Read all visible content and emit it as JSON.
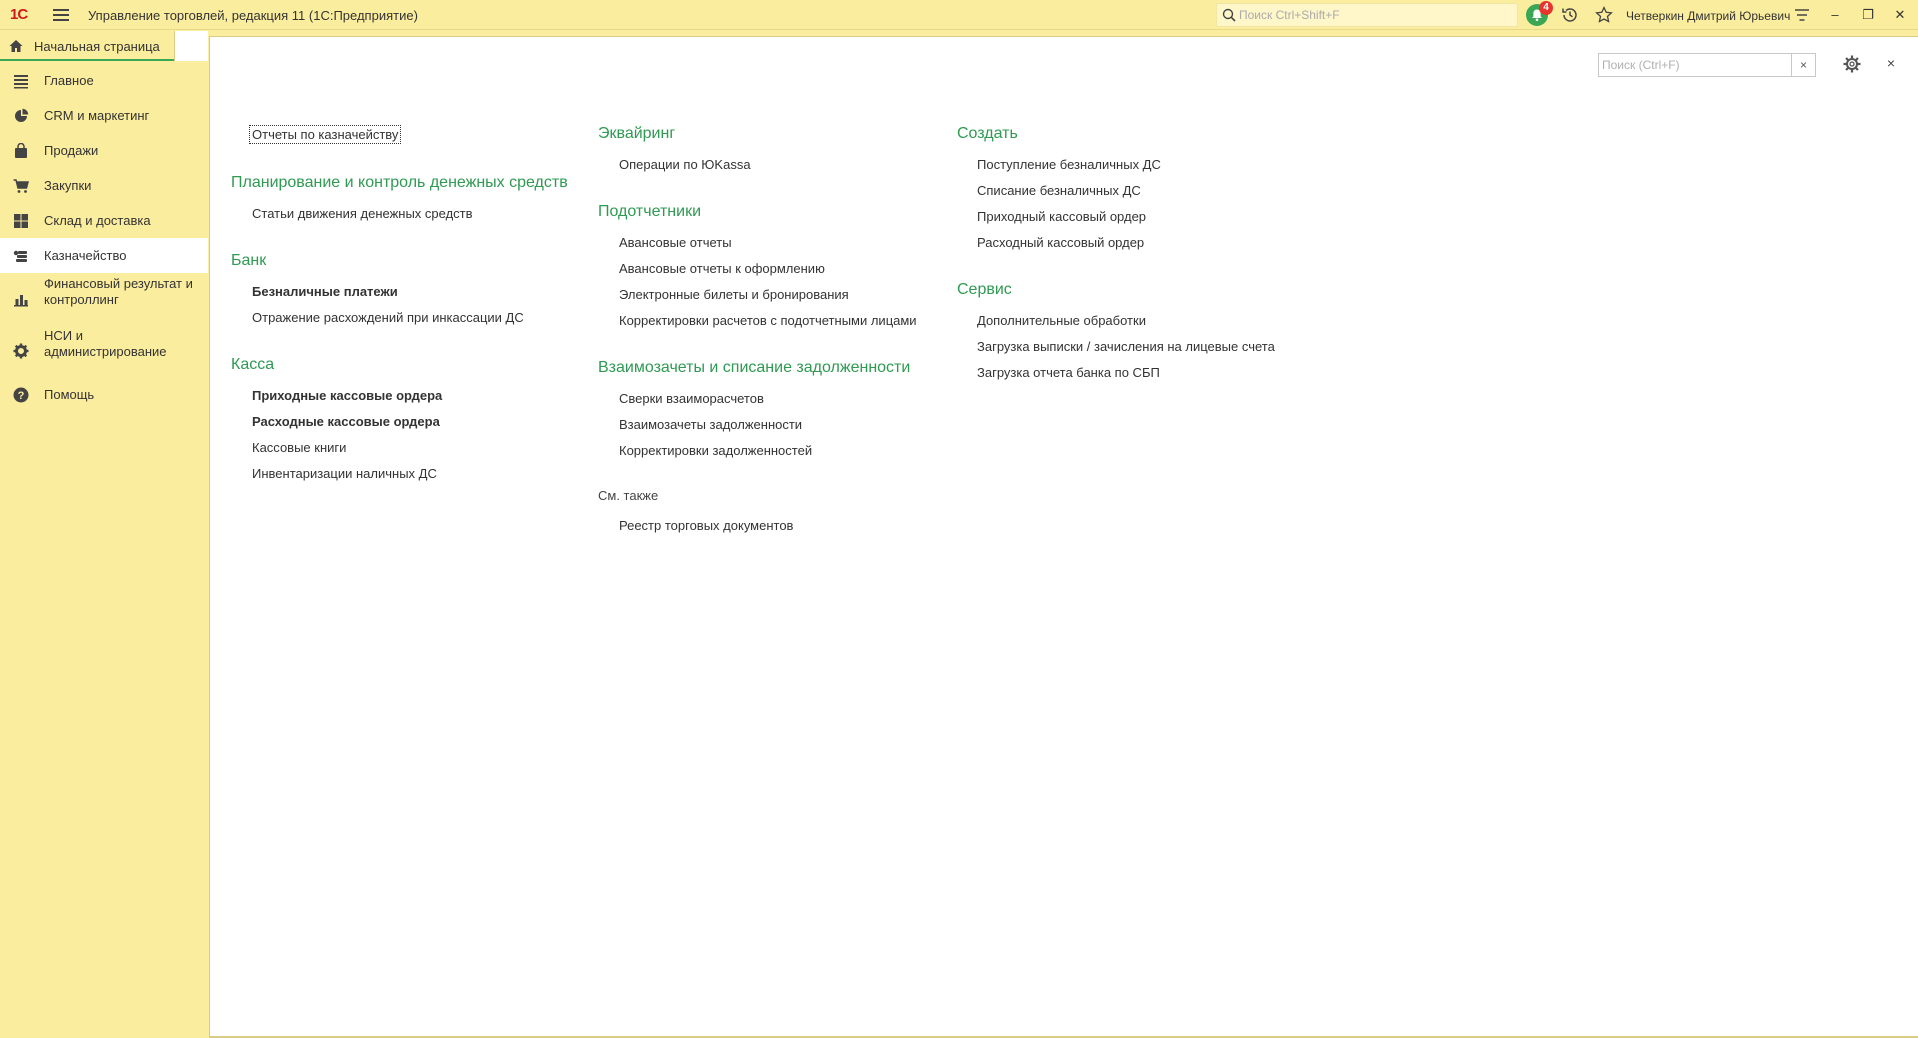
{
  "app": {
    "logo": "1С",
    "title": "Управление торговлей, редакция 11  (1С:Предприятие)",
    "search_placeholder": "Поиск Ctrl+Shift+F",
    "notifications_count": "4",
    "user": "Четверкин Дмитрий Юрьевич"
  },
  "tabs": {
    "home": "Начальная страница"
  },
  "sidebar": {
    "items": [
      {
        "label": "Главное",
        "icon": "list-icon"
      },
      {
        "label": "CRM и маркетинг",
        "icon": "pie-chart-icon"
      },
      {
        "label": "Продажи",
        "icon": "bag-icon"
      },
      {
        "label": "Закупки",
        "icon": "cart-icon"
      },
      {
        "label": "Склад и доставка",
        "icon": "warehouse-grid-icon"
      },
      {
        "label": "Казначейство",
        "icon": "coins-icon"
      },
      {
        "label": "Финансовый результат и контроллинг",
        "icon": "bar-chart-icon"
      },
      {
        "label": "НСИ и администрирование",
        "icon": "gear-icon"
      },
      {
        "label": "Помощь",
        "icon": "help-icon"
      }
    ],
    "active": "Казначейство"
  },
  "form": {
    "search_placeholder": "Поиск (Ctrl+F)",
    "clear": "×",
    "close": "×"
  },
  "content": {
    "col1": {
      "top_link": "Отчеты по казначейству",
      "groups": [
        {
          "title": "Планирование и контроль денежных средств",
          "links": [
            {
              "label": "Статьи движения денежных средств",
              "bold": false
            }
          ]
        },
        {
          "title": "Банк",
          "links": [
            {
              "label": "Безналичные платежи",
              "bold": true
            },
            {
              "label": "Отражение расхождений при инкассации ДС",
              "bold": false
            }
          ]
        },
        {
          "title": "Касса",
          "links": [
            {
              "label": "Приходные кассовые ордера",
              "bold": true
            },
            {
              "label": "Расходные кассовые ордера",
              "bold": true
            },
            {
              "label": "Кассовые книги",
              "bold": false
            },
            {
              "label": "Инвентаризации наличных ДС",
              "bold": false
            }
          ]
        }
      ]
    },
    "col2": {
      "groups": [
        {
          "title": "Эквайринг",
          "links": [
            {
              "label": "Операции по ЮKassa"
            }
          ]
        },
        {
          "title": "Подотчетники",
          "links": [
            {
              "label": "Авансовые отчеты"
            },
            {
              "label": "Авансовые отчеты к оформлению"
            },
            {
              "label": "Электронные билеты и бронирования"
            },
            {
              "label": "Корректировки расчетов с подотчетными лицами"
            }
          ]
        },
        {
          "title": "Взаимозачеты и списание задолженности",
          "links": [
            {
              "label": "Сверки взаиморасчетов"
            },
            {
              "label": "Взаимозачеты задолженности"
            },
            {
              "label": "Корректировки задолженностей"
            }
          ]
        }
      ],
      "see_also_title": "См. также",
      "see_also_links": [
        {
          "label": "Реестр торговых документов"
        }
      ]
    },
    "col3": {
      "groups": [
        {
          "title": "Создать",
          "links": [
            {
              "label": "Поступление безналичных ДС"
            },
            {
              "label": "Списание безналичных ДС"
            },
            {
              "label": "Приходный кассовый ордер"
            },
            {
              "label": "Расходный кассовый ордер"
            }
          ]
        },
        {
          "title": "Сервис",
          "links": [
            {
              "label": "Дополнительные обработки"
            },
            {
              "label": "Загрузка выписки / зачисления на лицевые счета"
            },
            {
              "label": "Загрузка отчета банка по СБП"
            }
          ]
        }
      ]
    }
  }
}
